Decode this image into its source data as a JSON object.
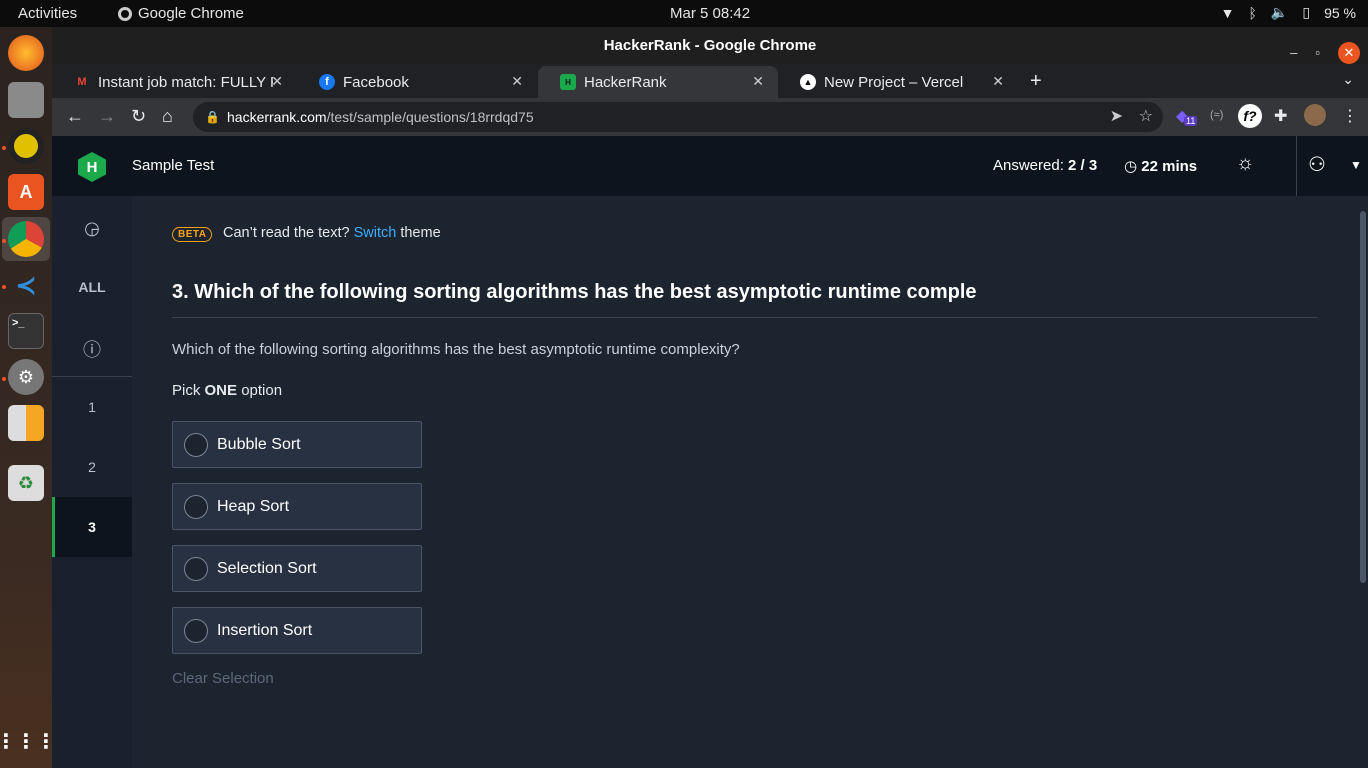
{
  "os": {
    "activities": "Activities",
    "app_name": "Google Chrome",
    "clock": "Mar 5  08:42",
    "battery": "95 %"
  },
  "window": {
    "title": "HackerRank - Google Chrome"
  },
  "tabs": [
    {
      "label": "Instant job match: FULLY R",
      "favicon": "gmail-icon"
    },
    {
      "label": "Facebook",
      "favicon": "facebook-icon"
    },
    {
      "label": "HackerRank",
      "favicon": "hackerrank-icon",
      "active": true
    },
    {
      "label": "New Project – Vercel",
      "favicon": "vercel-icon"
    }
  ],
  "omnibox": {
    "host": "hackerrank.com",
    "path": "/test/sample/questions/18rrdqd75"
  },
  "extensions": {
    "badge": "11"
  },
  "header": {
    "logo_letter": "H",
    "test_name": "Sample Test",
    "answered_label": "Answered:",
    "answered_value": "2 / 3",
    "timer": "22 mins"
  },
  "sidebar": {
    "all_label": "ALL",
    "questions": [
      "1",
      "2",
      "3"
    ],
    "current": "3"
  },
  "banner": {
    "badge": "BETA",
    "text_before": "Can’t read the text?",
    "link": "Switch",
    "text_after": "theme"
  },
  "question": {
    "title": "3. Which of the following sorting algorithms has the best asymptotic runtime comple",
    "body": "Which of the following sorting algorithms has the best asymptotic runtime complexity?",
    "pick_prefix": "Pick",
    "pick_strong": "ONE",
    "pick_suffix": "option",
    "options": [
      "Bubble Sort",
      "Heap Sort",
      "Selection Sort",
      "Insertion Sort"
    ],
    "clear_label": "Clear Selection"
  },
  "colors": {
    "accent_green": "#1ba94c",
    "link_blue": "#3dadfc",
    "beta_orange": "#ffa116",
    "background": "#1c2430"
  }
}
